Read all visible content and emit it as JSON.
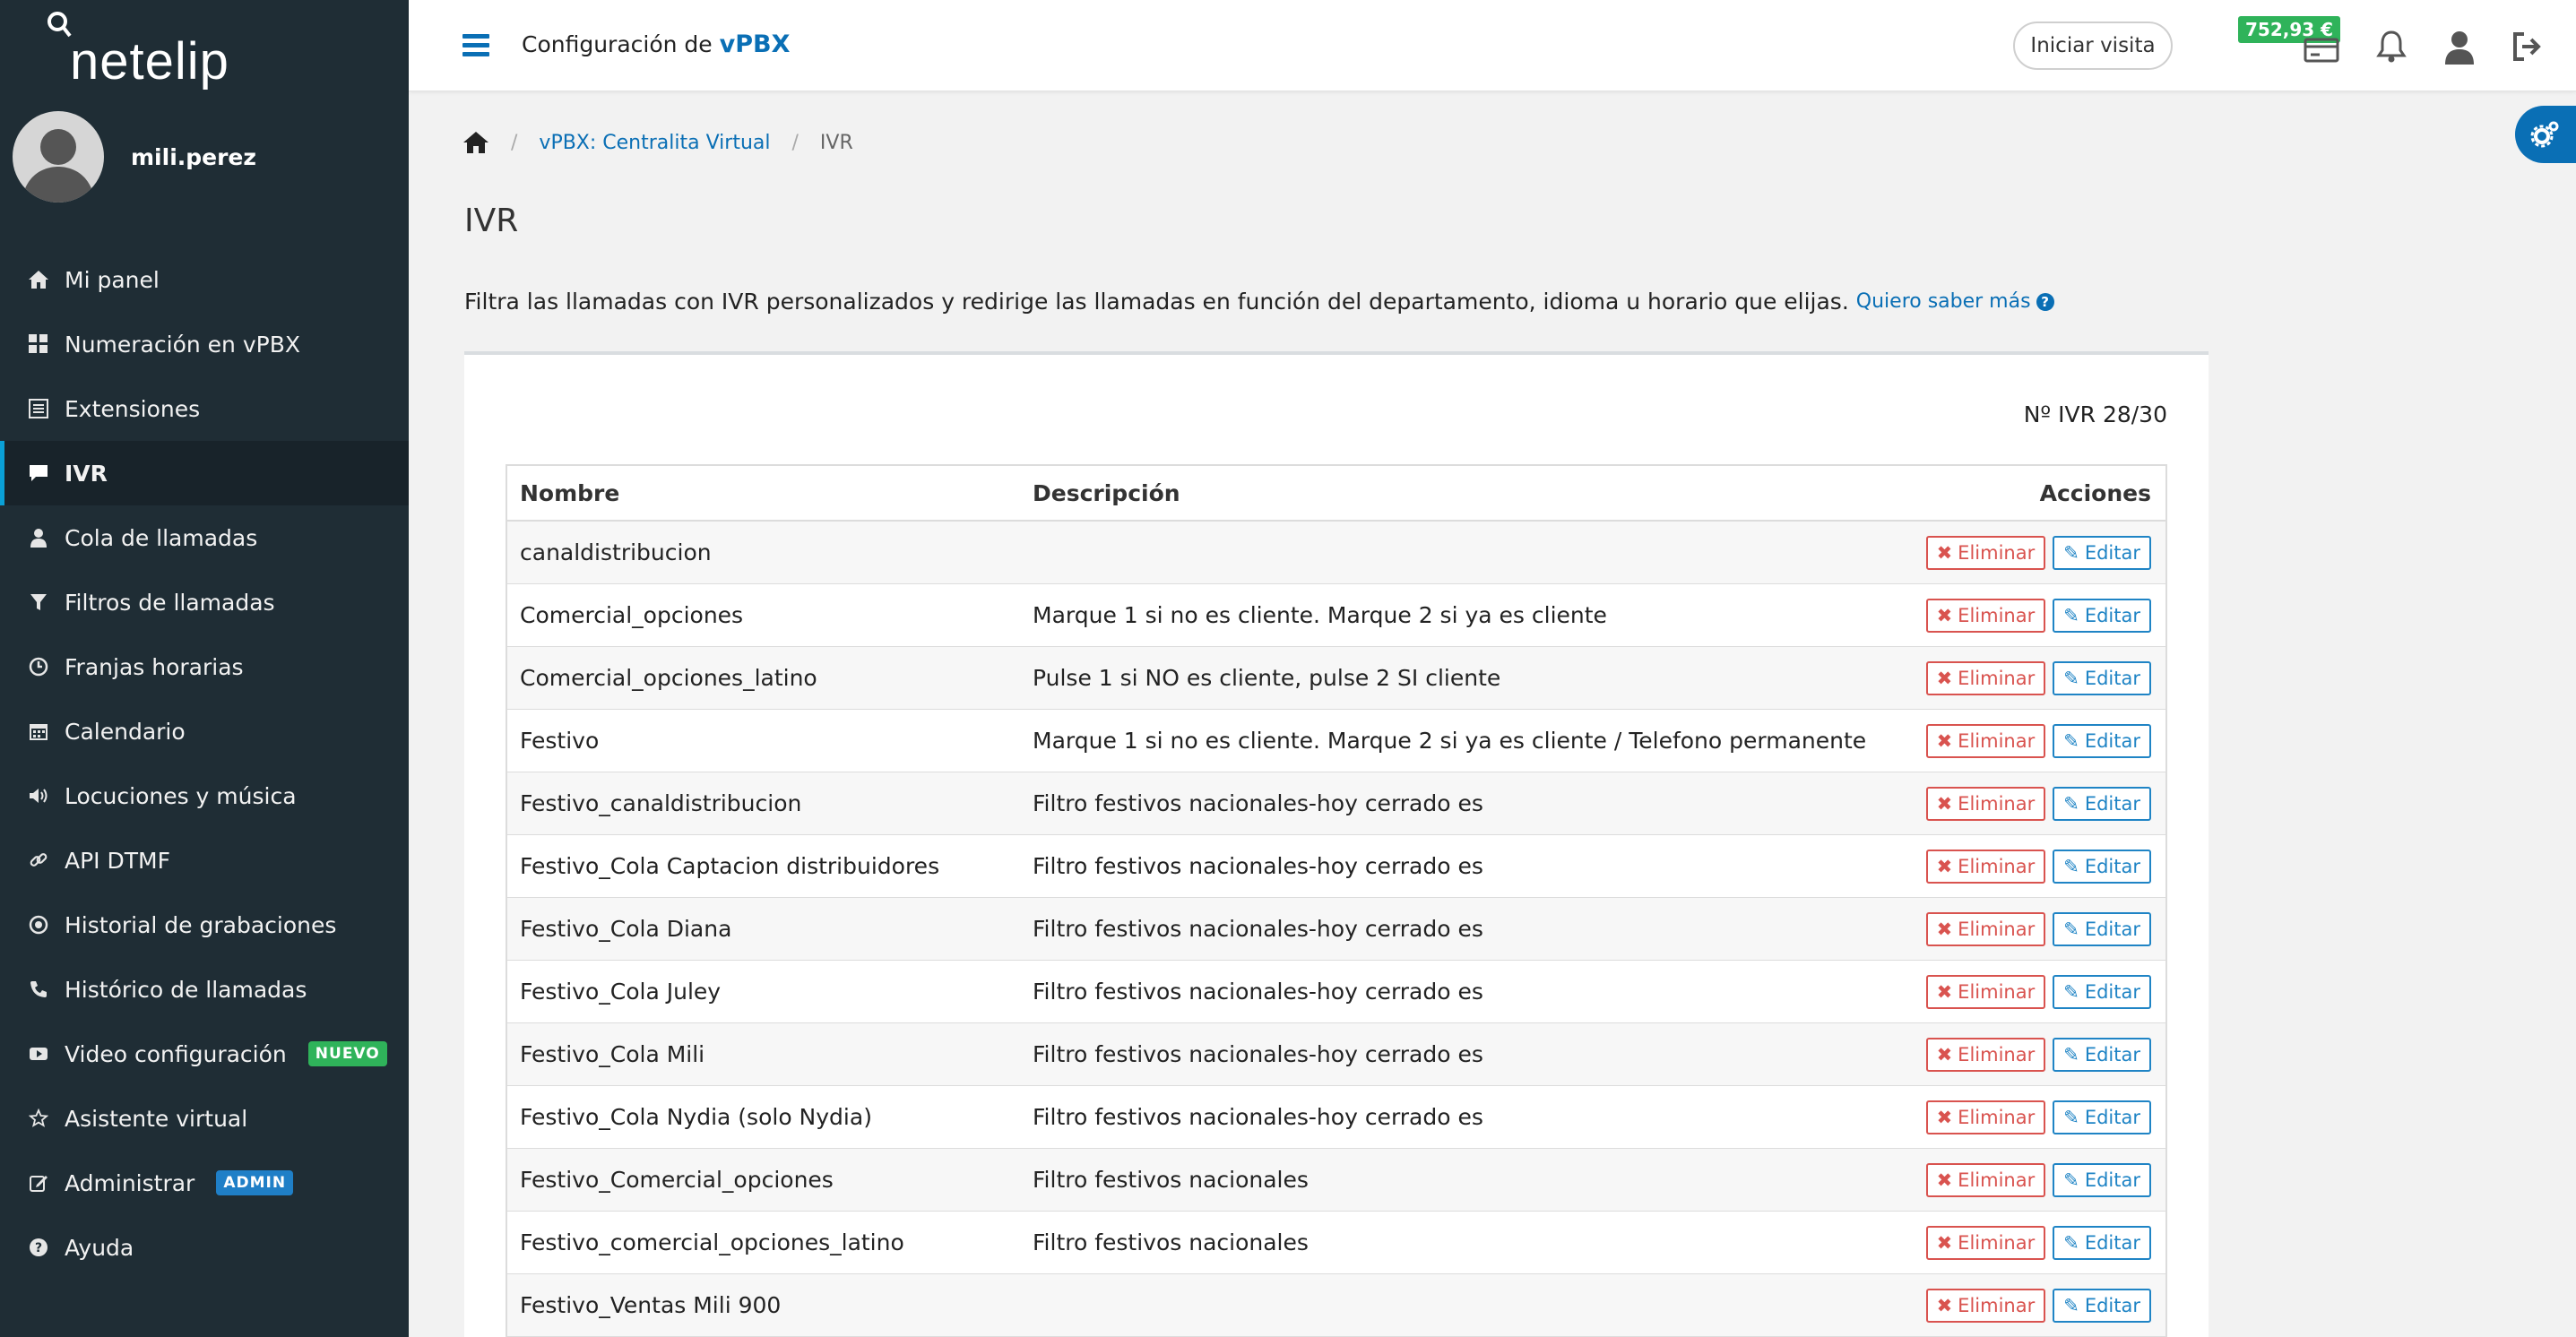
{
  "brand": {
    "logo_text": "netelip"
  },
  "user": {
    "username": "mili.perez"
  },
  "sidebar": {
    "items": [
      {
        "label": "Mi panel",
        "icon": "home-icon"
      },
      {
        "label": "Numeración en vPBX",
        "icon": "grid-icon"
      },
      {
        "label": "Extensiones",
        "icon": "list-icon"
      },
      {
        "label": "IVR",
        "icon": "chat-icon",
        "active": true
      },
      {
        "label": "Cola de llamadas",
        "icon": "user-icon"
      },
      {
        "label": "Filtros de llamadas",
        "icon": "filter-icon"
      },
      {
        "label": "Franjas horarias",
        "icon": "clock-icon"
      },
      {
        "label": "Calendario",
        "icon": "calendar-icon"
      },
      {
        "label": "Locuciones y música",
        "icon": "speaker-icon"
      },
      {
        "label": "API DTMF",
        "icon": "link-icon"
      },
      {
        "label": "Historial de grabaciones",
        "icon": "record-icon"
      },
      {
        "label": "Histórico de llamadas",
        "icon": "phone-icon"
      },
      {
        "label": "Video configuración",
        "icon": "video-icon",
        "badge": "NUEVO"
      },
      {
        "label": "Asistente virtual",
        "icon": "star-icon"
      },
      {
        "label": "Administrar",
        "icon": "edit-icon",
        "badge": "ADMIN"
      },
      {
        "label": "Ayuda",
        "icon": "help-icon"
      }
    ]
  },
  "topbar": {
    "title_prefix": "Configuración de",
    "title_brand": "vPBX",
    "start_visit": "Iniciar visita",
    "balance": "752,93 €"
  },
  "breadcrumb": {
    "section": "vPBX: Centralita Virtual",
    "current": "IVR"
  },
  "page": {
    "title": "IVR",
    "intro": "Filtra las llamadas con IVR personalizados y redirige las llamadas en función del departamento, idioma u horario que elijas.",
    "intro_link": "Quiero saber más",
    "ivr_count": "Nº IVR 28/30"
  },
  "table": {
    "headers": {
      "name": "Nombre",
      "description": "Descripción",
      "actions": "Acciones"
    },
    "delete_label": "Eliminar",
    "edit_label": "Editar",
    "rows": [
      {
        "name": "canaldistribucion",
        "description": ""
      },
      {
        "name": "Comercial_opciones",
        "description": "Marque 1 si no es cliente. Marque 2 si ya es cliente"
      },
      {
        "name": "Comercial_opciones_latino",
        "description": "Pulse 1 si NO es cliente, pulse 2 SI cliente"
      },
      {
        "name": "Festivo",
        "description": "Marque 1 si no es cliente. Marque 2 si ya es cliente / Telefono permanente"
      },
      {
        "name": "Festivo_canaldistribucion",
        "description": "Filtro festivos nacionales-hoy cerrado es"
      },
      {
        "name": "Festivo_Cola Captacion distribuidores",
        "description": "Filtro festivos nacionales-hoy cerrado es"
      },
      {
        "name": "Festivo_Cola Diana",
        "description": "Filtro festivos nacionales-hoy cerrado es"
      },
      {
        "name": "Festivo_Cola Juley",
        "description": "Filtro festivos nacionales-hoy cerrado es"
      },
      {
        "name": "Festivo_Cola Mili",
        "description": "Filtro festivos nacionales-hoy cerrado es"
      },
      {
        "name": "Festivo_Cola Nydia (solo Nydia)",
        "description": "Filtro festivos nacionales-hoy cerrado es"
      },
      {
        "name": "Festivo_Comercial_opciones",
        "description": "Filtro festivos nacionales"
      },
      {
        "name": "Festivo_comercial_opciones_latino",
        "description": "Filtro festivos nacionales"
      },
      {
        "name": "Festivo_Ventas Mili 900",
        "description": ""
      }
    ]
  },
  "colors": {
    "sidebar": "#1f2d35",
    "accent": "#0a6fb5",
    "danger": "#d9534f",
    "success": "#2fb35a"
  }
}
